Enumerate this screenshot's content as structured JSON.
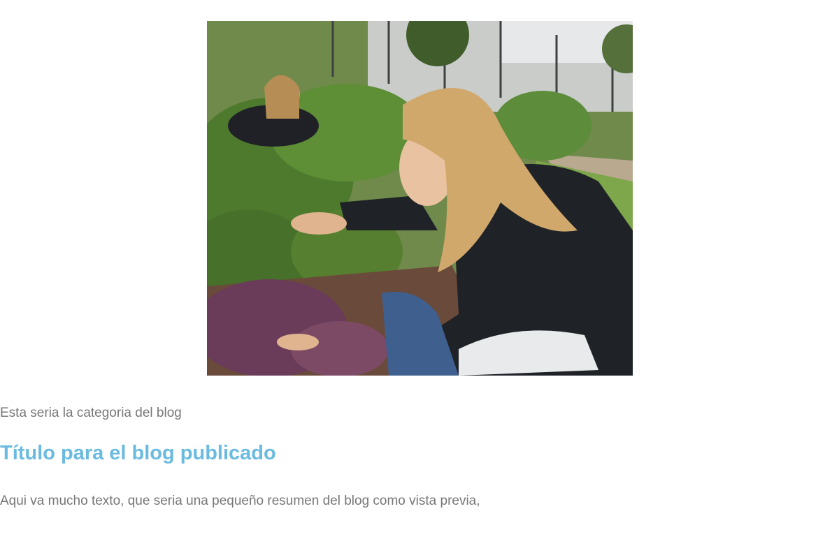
{
  "post": {
    "image": {
      "icon": "photo-garden",
      "alt": ""
    },
    "category": "Esta seria la categoria del blog",
    "title": "Título para el blog publicado",
    "excerpt": "Aqui va mucho texto, que seria una pequeño resumen del blog como vista previa,"
  },
  "colors": {
    "title": "#6bbbe0",
    "text": "#777777",
    "background": "#ffffff"
  }
}
